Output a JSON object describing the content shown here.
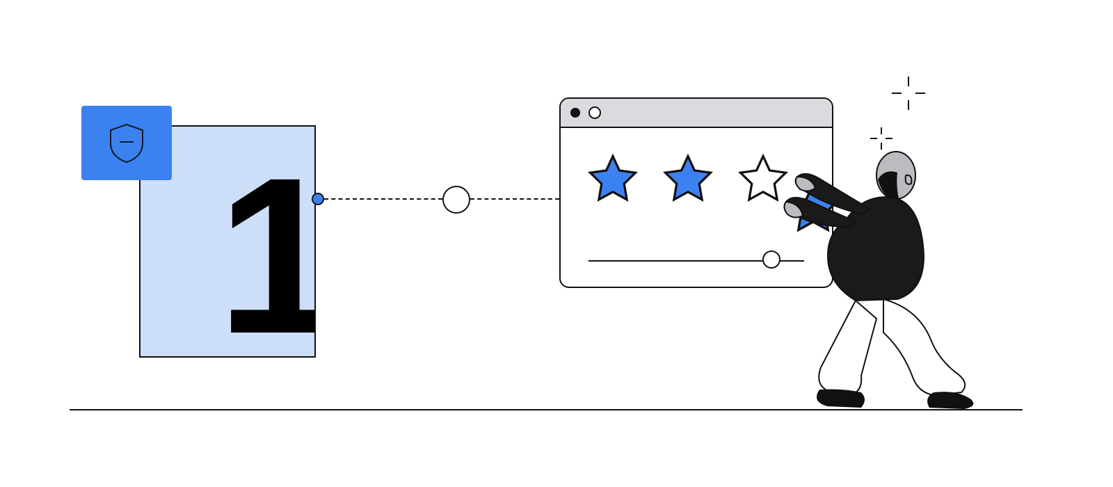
{
  "illustration": {
    "step_number": "1",
    "folder": {
      "icon": "shield-minus"
    },
    "connector": {
      "style": "dashed",
      "start": "step-card",
      "end": "review-window"
    },
    "review_window": {
      "title_bar_dots": [
        "filled",
        "hollow"
      ],
      "stars": [
        {
          "state": "filled"
        },
        {
          "state": "filled"
        },
        {
          "state": "empty"
        },
        {
          "state": "held"
        }
      ],
      "slider": {
        "value_pct": 88
      }
    },
    "person": {
      "pose": "kneeling",
      "action": "placing-star"
    },
    "sparkles": 2,
    "ground_line": true
  },
  "colors": {
    "accent_blue": "#3c81f0",
    "pale_blue": "#cddff8",
    "ink": "#111111",
    "titlebar_gray": "#d9dbde",
    "skin": "#babcbf",
    "shirt": "#1a1a1a"
  }
}
